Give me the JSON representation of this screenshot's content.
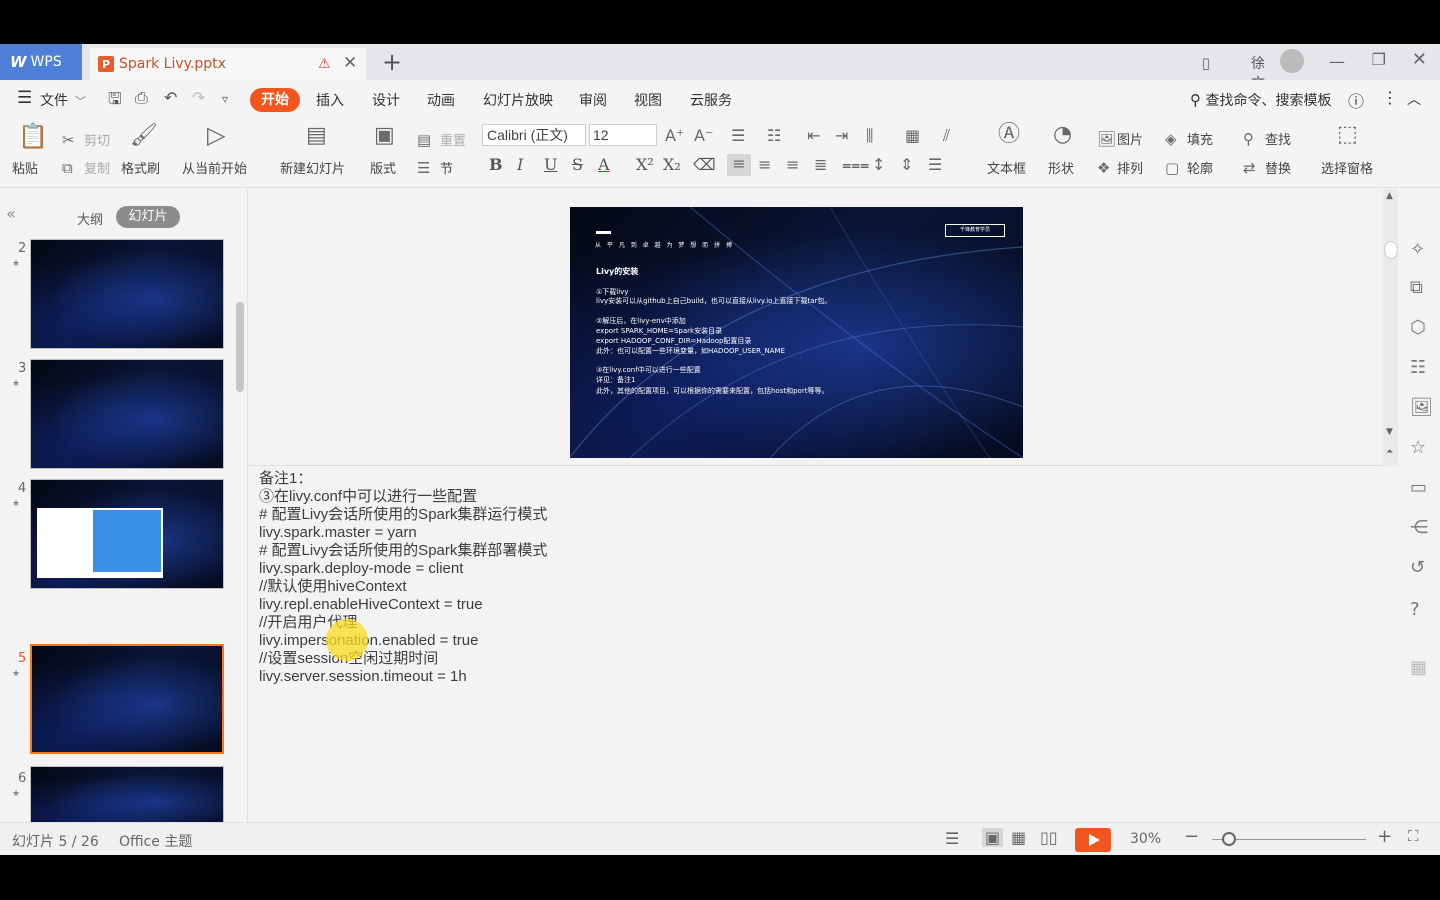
{
  "titlebar": {
    "app_name": "WPS",
    "doc_title": "Spark Livy.pptx",
    "user_name": "徐文波"
  },
  "menubar": {
    "file_label": "文件",
    "tabs": [
      "开始",
      "插入",
      "设计",
      "动画",
      "幻灯片放映",
      "审阅",
      "视图",
      "云服务"
    ],
    "search_label": "查找命令、搜索模板"
  },
  "ribbon": {
    "paste": "粘贴",
    "cut": "剪切",
    "copy": "复制",
    "format_painter": "格式刷",
    "from_current": "从当前开始",
    "new_slide": "新建幻灯片",
    "layout": "版式",
    "reset": "重置",
    "section": "节",
    "font_name": "Calibri (正文)",
    "font_size": "12",
    "text_box": "文本框",
    "shapes": "形状",
    "picture": "图片",
    "fill": "填充",
    "arrange": "排列",
    "outline": "轮廓",
    "find": "查找",
    "replace": "替换",
    "selection_pane": "选择窗格"
  },
  "leftpanel": {
    "outline_tab": "大纲",
    "slides_tab": "幻灯片",
    "thumbnails": [
      {
        "num": "2",
        "selected": false
      },
      {
        "num": "3",
        "selected": false
      },
      {
        "num": "4",
        "selected": false
      },
      {
        "num": "5",
        "selected": true
      },
      {
        "num": "6",
        "selected": false
      }
    ]
  },
  "slide": {
    "subtitle": "从 平 凡 到 卓 越   为 梦 想 而 拼 搏",
    "brand": "千锋教育学员",
    "title": "Livy的安装",
    "lines": [
      "①下载livy",
      "livy安装可以从github上自己build，也可以直接从livy.io上直接下载tar包。",
      "②解压后，在livy-env中添加",
      "export SPARK_HOME=Spark安装目录",
      "export HADOOP_CONF_DIR=Hadoop配置目录",
      "此外：也可以配置一些环境变量，如HADOOP_USER_NAME",
      "③在livy.conf中可以进行一些配置",
      "详见：备注1",
      "此外，其他的配置项目，可以根据你的需要来配置，包括host和port等等。"
    ]
  },
  "notes": [
    "备注1：",
    "③在livy.conf中可以进行一些配置",
    "# 配置Livy会话所使用的Spark集群运行模式",
    "livy.spark.master = yarn",
    "# 配置Livy会话所使用的Spark集群部署模式",
    "livy.spark.deploy-mode = client",
    "//默认使用hiveContext",
    "livy.repl.enableHiveContext = true",
    "//开启用户代理",
    "livy.impersonation.enabled = true",
    "//设置session空闲过期时间",
    "livy.server.session.timeout = 1h"
  ],
  "statusbar": {
    "slide_counter": "幻灯片 5 / 26",
    "theme": "Office 主题",
    "zoom": "30%"
  },
  "colors": {
    "accent": "#f3551e",
    "wps_blue": "#4e80d8"
  }
}
